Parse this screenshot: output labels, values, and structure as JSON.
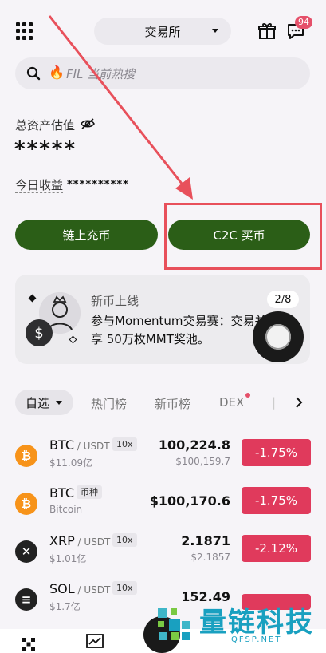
{
  "header": {
    "exchange_label": "交易所",
    "badge_count": "94"
  },
  "search": {
    "placeholder": "FIL 当前热搜"
  },
  "assets": {
    "label": "总资产估值",
    "value": "*****",
    "today_label": "今日收益",
    "today_value": "**********"
  },
  "actions": {
    "chain_deposit": "链上充币",
    "c2c_buy": "C2C 买币"
  },
  "promo": {
    "title": "新币上线",
    "text": "参与Momentum交易赛：交易并分享 50万枚MMT奖池。",
    "pager": "2/8"
  },
  "tabs": {
    "selected": "自选",
    "items": [
      "热门榜",
      "新币榜",
      "DEX"
    ]
  },
  "markets": [
    {
      "symbol": "BTC",
      "quote": " / USDT",
      "tag": "10x",
      "sub": "$11.09亿",
      "price": "100,224.8",
      "price_sub": "$100,159.7",
      "change": "-1.75%",
      "coin": "₿",
      "color": "#f7931a"
    },
    {
      "symbol": "BTC",
      "quote": "",
      "tag": "币种",
      "sub": "Bitcoin",
      "price": "$100,170.6",
      "price_sub": "",
      "change": "-1.75%",
      "coin": "₿",
      "color": "#f7931a"
    },
    {
      "symbol": "XRP",
      "quote": " / USDT",
      "tag": "10x",
      "sub": "$1.01亿",
      "price": "2.1871",
      "price_sub": "$2.1857",
      "change": "-2.12%",
      "coin": "✕",
      "color": "#222222"
    },
    {
      "symbol": "SOL",
      "quote": " / USDT",
      "tag": "10x",
      "sub": "$1.7亿",
      "price": "152.49",
      "price_sub": "",
      "change": "",
      "coin": "≡",
      "color": "#222222"
    }
  ],
  "watermark": {
    "text": "量链科技",
    "sub": "QFSP.NET"
  },
  "colors": {
    "accent_green": "#2b5e17",
    "down_red": "#e03a5c",
    "annotation_red": "#e8505b"
  }
}
